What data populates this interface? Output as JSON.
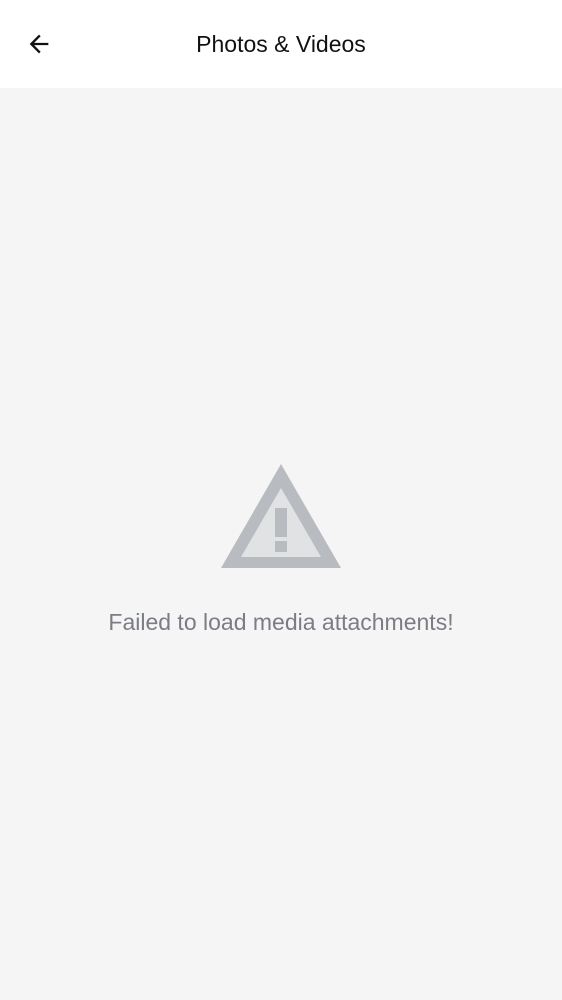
{
  "header": {
    "title": "Photos & Videos",
    "back_icon": "arrow-left-icon"
  },
  "empty_state": {
    "icon": "warning-icon",
    "message": "Failed to load media attachments!"
  },
  "colors": {
    "background": "#f5f5f5",
    "header_background": "#ffffff",
    "title": "#111111",
    "message": "#7a7d85",
    "warning_outline": "#b8bbc0",
    "warning_fill": "#e1e2e4"
  }
}
